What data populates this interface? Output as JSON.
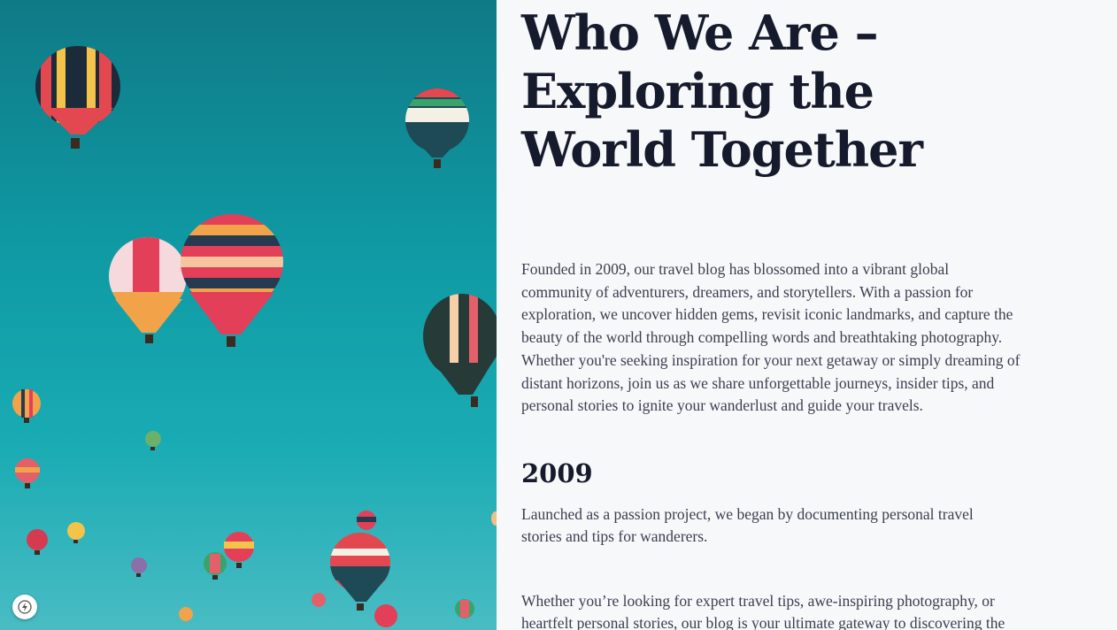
{
  "hero": {
    "image": "hot-air-balloons-sky",
    "sky_colors": [
      "#0f7a86",
      "#19abb3",
      "#49bcc3"
    ]
  },
  "about": {
    "title": "Who We Are – Exploring the World Together",
    "intro": "Founded in 2009, our travel blog has blossomed into a vibrant global community of adventurers, dreamers, and storytellers. With a passion for exploration, we uncover hidden gems, revisit iconic landmarks, and capture the beauty of the world through compelling words and breathtaking photography. Whether you're seeking inspiration for your next getaway or simply dreaming of distant horizons, join us as we share unforgettable journeys, insider tips, and personal stories to ignite your wanderlust and guide your travels.",
    "milestone": {
      "year": "2009",
      "text": "Launched as a passion project, we began by documenting personal travel stories and tips for wanderers."
    },
    "closing": "Whether you’re looking for expert travel tips, awe-inspiring photography, or heartfelt personal stories, our blog is your ultimate gateway to discovering the"
  },
  "badge": {
    "icon": "lightning-bolt-icon"
  },
  "colors": {
    "heading": "#151a2c",
    "body_text": "#3b4050",
    "background": "#f7f8fa"
  }
}
